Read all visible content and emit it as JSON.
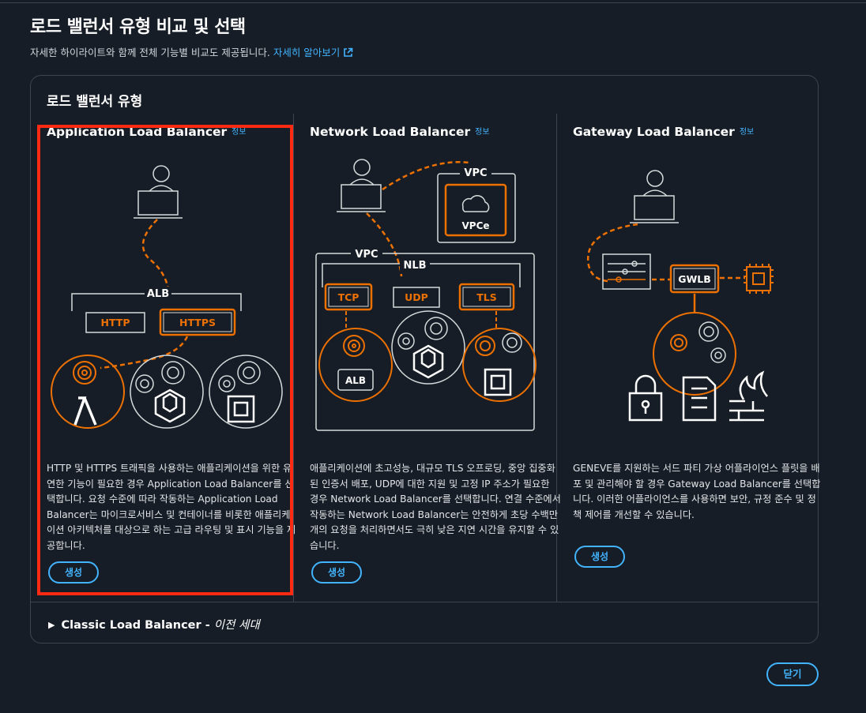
{
  "page": {
    "title": "로드 밸런서 유형 비교 및 선택",
    "description": "자세한 하이라이트와 함께 전체 기능별 비교도 제공됩니다.",
    "learn_more": "자세히 알아보기"
  },
  "section": {
    "title": "로드 밸런서 유형"
  },
  "cards": [
    {
      "title": "Application Load Balancer",
      "info": "정보",
      "description": "HTTP 및 HTTPS 트래픽을 사용하는 애플리케이션을 위한 유연한 기능이 필요한 경우 Application Load Balancer를 선택합니다. 요청 수준에 따라 작동하는 Application Load Balancer는 마이크로서비스 및 컨테이너를 비롯한 애플리케이션 아키텍처를 대상으로 하는 고급 라우팅 및 표시 기능을 제공합니다.",
      "create_label": "생성",
      "diagram_labels": {
        "alb": "ALB",
        "http": "HTTP",
        "https": "HTTPS"
      },
      "selected": true
    },
    {
      "title": "Network Load Balancer",
      "info": "정보",
      "description": "애플리케이션에 초고성능, 대규모 TLS 오프로딩, 중앙 집중화된 인증서 배포, UDP에 대한 지원 및 고정 IP 주소가 필요한 경우 Network Load Balancer를 선택합니다. 연결 수준에서 작동하는 Network Load Balancer는 안전하게 초당 수백만 개의 요청을 처리하면서도 극히 낮은 지연 시간을 유지할 수 있습니다.",
      "create_label": "생성",
      "diagram_labels": {
        "vpc_top": "VPC",
        "vpce": "VPCe",
        "vpc": "VPC",
        "nlb": "NLB",
        "tcp": "TCP",
        "udp": "UDP",
        "tls": "TLS",
        "alb": "ALB"
      }
    },
    {
      "title": "Gateway Load Balancer",
      "info": "정보",
      "description": "GENEVE를 지원하는 서드 파티 가상 어플라이언스 플릿을 배포 및 관리해야 할 경우 Gateway Load Balancer를 선택합니다. 이러한 어플라이언스를 사용하면 보안, 규정 준수 및 정책 제어를 개선할 수 있습니다.",
      "create_label": "생성",
      "diagram_labels": {
        "gwlb": "GWLB"
      }
    }
  ],
  "classic": {
    "label": "Classic Load Balancer - ",
    "generation": "이전 세대"
  },
  "close_label": "닫기",
  "colors": {
    "accent": "#42b4ff",
    "orange": "#ed7100",
    "highlight": "#ff2a12",
    "background": "#161d26"
  },
  "icons": [
    "external-link-icon",
    "user-laptop-icon",
    "target-icon",
    "lambda-icon",
    "container-icon",
    "chip-icon",
    "cloud-icon",
    "filter-icon",
    "lock-icon",
    "checklist-icon",
    "firewall-icon",
    "caret-right-icon"
  ]
}
